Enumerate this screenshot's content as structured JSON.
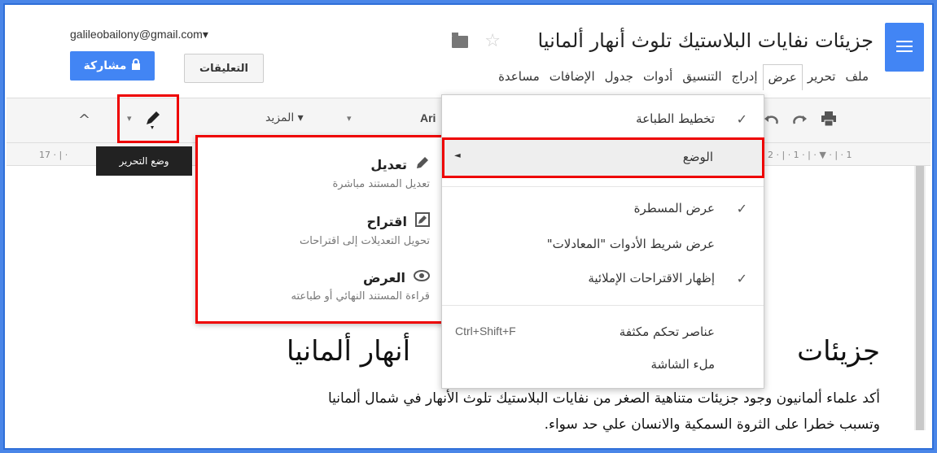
{
  "header": {
    "doc_title": "جزيئات نفايات البلاستيك تلوث أنهار ألمانيا",
    "email": "galileobailony@gmail.com▾",
    "share_label": "مشاركة",
    "comments_label": "التعليقات",
    "menu": [
      "ملف",
      "تحرير",
      "عرض",
      "إدراج",
      "التنسيق",
      "أدوات",
      "جدول",
      "الإضافات",
      "مساعدة"
    ]
  },
  "toolbar": {
    "more_label": "المزيد ▾",
    "font_partial": "Ari",
    "dropdown_arrow": "▾",
    "collapse_glyph": "^"
  },
  "ruler": {
    "left_marks": "17 · | ·",
    "right_marks": "2 · | · 1 · | · ▼ · | · 1"
  },
  "tooltip": {
    "label": "وضع التحرير"
  },
  "modes": [
    {
      "title": "تعديل",
      "desc": "تعديل المستند مباشرة",
      "icon": "pencil-icon"
    },
    {
      "title": "اقتراح",
      "desc": "تحويل التعديلات إلى اقتراحات",
      "icon": "suggest-icon"
    },
    {
      "title": "العرض",
      "desc": "قراءة المستند النهائي أو طباعته",
      "icon": "eye-icon"
    }
  ],
  "view_menu": {
    "print_layout": "تخطيط الطباعة",
    "mode": "الوضع",
    "show_ruler": "عرض المسطرة",
    "show_equation_toolbar": "عرض شريط الأدوات \"المعادلات\"",
    "show_spelling": "إظهار الاقتراحات الإملائية",
    "compact_controls": "عناصر تحكم مكثفة",
    "compact_shortcut": "Ctrl+Shift+F",
    "fullscreen": "ملء الشاشة"
  },
  "document": {
    "heading_right": "جزيئات",
    "heading_left": "أنهار ألمانيا",
    "line1": "أكد علماء ألمانيون وجود جزيئات متناهية الصغر من نفايات البلاستيك تلوث الأنهار في شمال ألمانيا",
    "line2": "وتسبب خطرا على الثروة السمكية والانسان علي حد سواء."
  }
}
